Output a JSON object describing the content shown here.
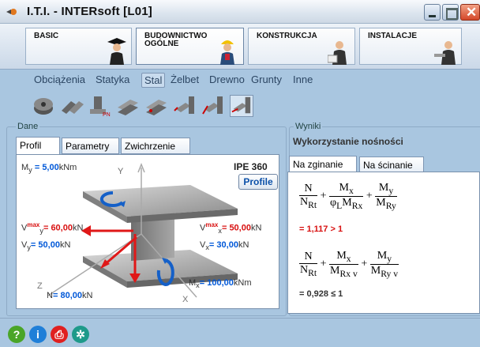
{
  "window": {
    "title": "I.T.I. - INTERsoft [L01]"
  },
  "categories": [
    {
      "label": "BASIC"
    },
    {
      "label": "BUDOWNICTWO OGÓLNE"
    },
    {
      "label": "KONSTRUKCJA"
    },
    {
      "label": "INSTALACJE"
    }
  ],
  "submenu": [
    "Obciążenia",
    "Statyka",
    "Stal",
    "Żelbet",
    "Drewno",
    "Grunty",
    "Inne"
  ],
  "submenu_active": "Stal",
  "left": {
    "group": "Dane",
    "tabs": [
      "Profil",
      "Parametry",
      "Zwichrzenie"
    ],
    "profile_name": "IPE 360",
    "profile_button": "Profile",
    "axes": {
      "y": "Y",
      "x": "X",
      "z": "Z"
    },
    "loads": {
      "My": {
        "sym": "M",
        "sub": "y",
        "eq": "=",
        "value": "5,00",
        "unit": "kNm"
      },
      "Vymax_left": {
        "sym": "V",
        "sub": "y",
        "sup": "max",
        "eq": "=",
        "value": "60,00",
        "unit": "kN"
      },
      "Vy": {
        "sym": "V",
        "sub": "y",
        "eq": "=",
        "value": "50,00",
        "unit": "kN"
      },
      "Vxmax": {
        "sym": "V",
        "sub": "x",
        "sup": "max",
        "eq": "=",
        "value": "50,00",
        "unit": "kN"
      },
      "Vx": {
        "sym": "V",
        "sub": "x",
        "eq": "=",
        "value": "30,00",
        "unit": "kN"
      },
      "Mx": {
        "sym": "M",
        "sub": "x",
        "eq": "=",
        "value": "100,00",
        "unit": "kNm"
      },
      "N": {
        "sym": "N",
        "eq": "=",
        "value": "80,00",
        "unit": "kN"
      }
    }
  },
  "right": {
    "group": "Wyniki",
    "heading": "Wykorzystanie nośności",
    "tabs": [
      "Na zginanie",
      "Na ścinanie"
    ],
    "f1": {
      "n1": "N",
      "d1": "N",
      "d1s": "Rt",
      "n2": "M",
      "n2s": "x",
      "d2": "φ",
      "d2s": "L",
      "d2b": "M",
      "d2bs": "Rx",
      "n3": "M",
      "n3s": "y",
      "d3": "M",
      "d3s": "Ry"
    },
    "result1": {
      "value": "= 1,117",
      "compare": "> 1"
    },
    "f2": {
      "n1": "N",
      "d1": "N",
      "d1s": "Rt",
      "n2": "M",
      "n2s": "x",
      "d2": "M",
      "d2s": "Rx v",
      "n3": "M",
      "n3s": "y",
      "d3": "M",
      "d3s": "Ry v"
    },
    "result2": {
      "value": "= 0,928",
      "compare": "≤ 1"
    }
  },
  "bottom": [
    "help-icon",
    "info-icon",
    "print-icon",
    "tools-icon"
  ],
  "colors": {
    "accent_blue": "#0058d8",
    "alert_red": "#d81010",
    "background": "#a9c6e0"
  }
}
